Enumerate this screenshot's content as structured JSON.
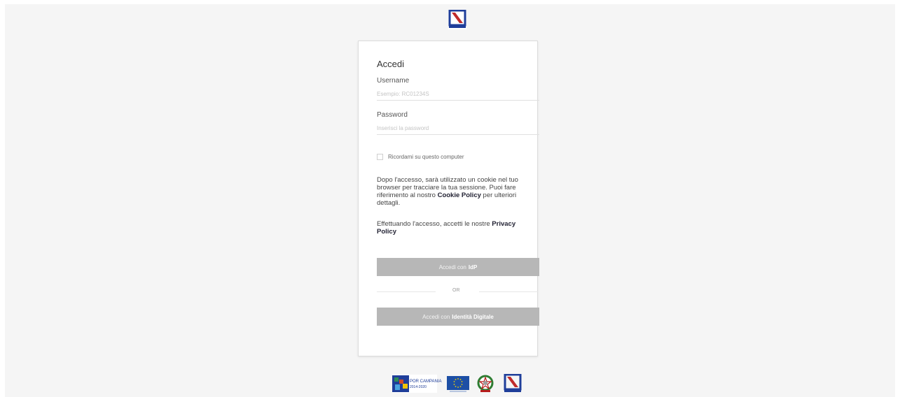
{
  "login": {
    "title": "Accedi",
    "username_label": "Username",
    "username_placeholder": "Esempio: RC01234S",
    "password_label": "Password",
    "password_placeholder": "Inserisci la password",
    "remember_label": "Ricordami su questo computer",
    "cookie_text_1": "Dopo l'accesso, sarà utilizzato un cookie nel tuo browser per tracciare la tua sessione. Puoi fare riferimento al nostro ",
    "cookie_link": "Cookie Policy",
    "cookie_text_2": " per ulteriori dettagli.",
    "privacy_text": "Effettuando l'accesso, accetti le nostre ",
    "privacy_link": "Privacy Policy",
    "idp_button_prefix": "Accedi con",
    "idp_button_bold": "IdP",
    "or_text": "OR",
    "digital_id_button_prefix": "Accedi con",
    "digital_id_button_bold": "Identità Digitale"
  },
  "footer": {
    "por_logo_text": "POR CAMPANIA",
    "por_logo_years": "2014-2020"
  },
  "colors": {
    "page_background": "#f5f5f5",
    "button_disabled": "#b7b7b7",
    "region_blue": "#1f3e9a",
    "eu_blue": "#1d4fa5",
    "eu_stars": "#f2d100"
  }
}
